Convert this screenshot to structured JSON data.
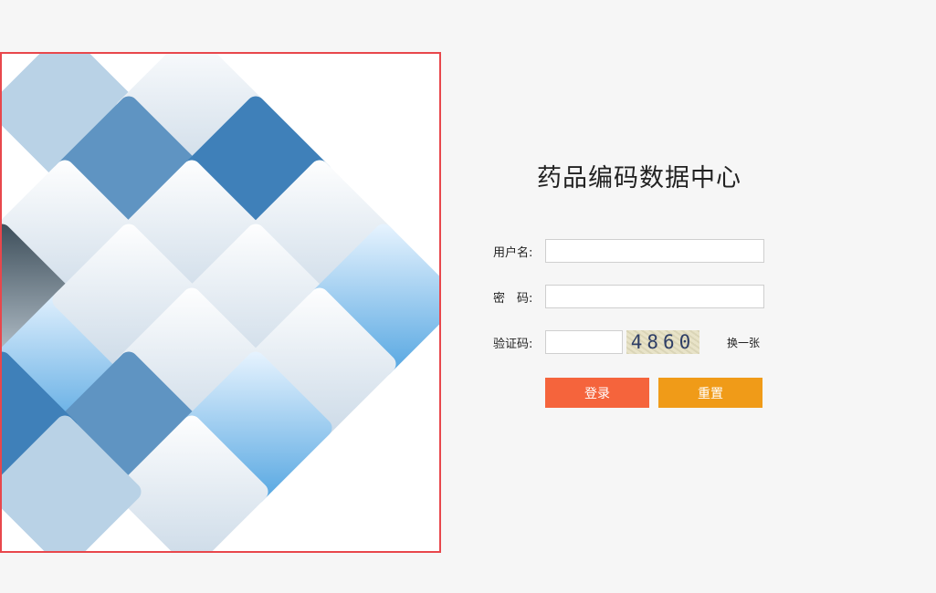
{
  "page": {
    "title": "药品编码数据中心"
  },
  "login_form": {
    "username_label": "用户名:",
    "username_value": "",
    "password_label": "密　码:",
    "password_value": "",
    "captcha_label": "验证码:",
    "captcha_value": "",
    "captcha_code": "4860",
    "refresh_captcha_label": "换一张",
    "login_button_label": "登录",
    "reset_button_label": "重置"
  },
  "hero": {
    "tiles": [
      "light-blue-tile",
      "medical-monitor-photo",
      "medium-blue-tile",
      "blue-tile",
      "chart-hand-photo",
      "pills-cross-photo",
      "chart-pen-photo",
      "hospital-building-photo",
      "digital-cubes-photo",
      "gear-pills-photo",
      "doctor-hand-photo",
      "globe-network-photo",
      "hospital-cross-photo",
      "white-pills-photo",
      "medium-blue-tile",
      "blue-tile",
      "keyboard-touch-photo",
      "laptop-photo",
      "light-blue-tile"
    ]
  },
  "colors": {
    "page_background": "#f6f6f6",
    "frame_border": "#e8474c",
    "login_button": "#f5643c",
    "reset_button": "#f09b18"
  }
}
